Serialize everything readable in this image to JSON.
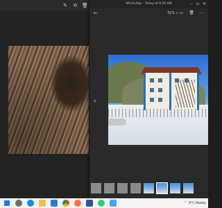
{
  "viewer": {
    "title": "WhatsApp - Today at 9:20 AM",
    "zoom": "31%"
  },
  "taskbar": {
    "weather": "9°C Mostly"
  },
  "icons": {
    "background_tools": [
      "edit-icon",
      "rotate-icon",
      "delete-icon"
    ],
    "viewer_tools": [
      "fit-to-window-icon",
      "delete-icon",
      "more-icon"
    ],
    "window_controls": [
      "minimize-icon",
      "maximize-icon",
      "close-icon"
    ],
    "taskbar_apps": [
      "search-icon",
      "edge-icon",
      "file-explorer-icon",
      "store-icon",
      "chrome-icon",
      "firefox-icon",
      "word-icon",
      "whatsapp-icon",
      "photos-icon"
    ]
  },
  "colors": {
    "viewer_bg": "#2a2a2a",
    "taskbar_bg": "#f3f3f3",
    "accent": "#1f7ae0"
  }
}
